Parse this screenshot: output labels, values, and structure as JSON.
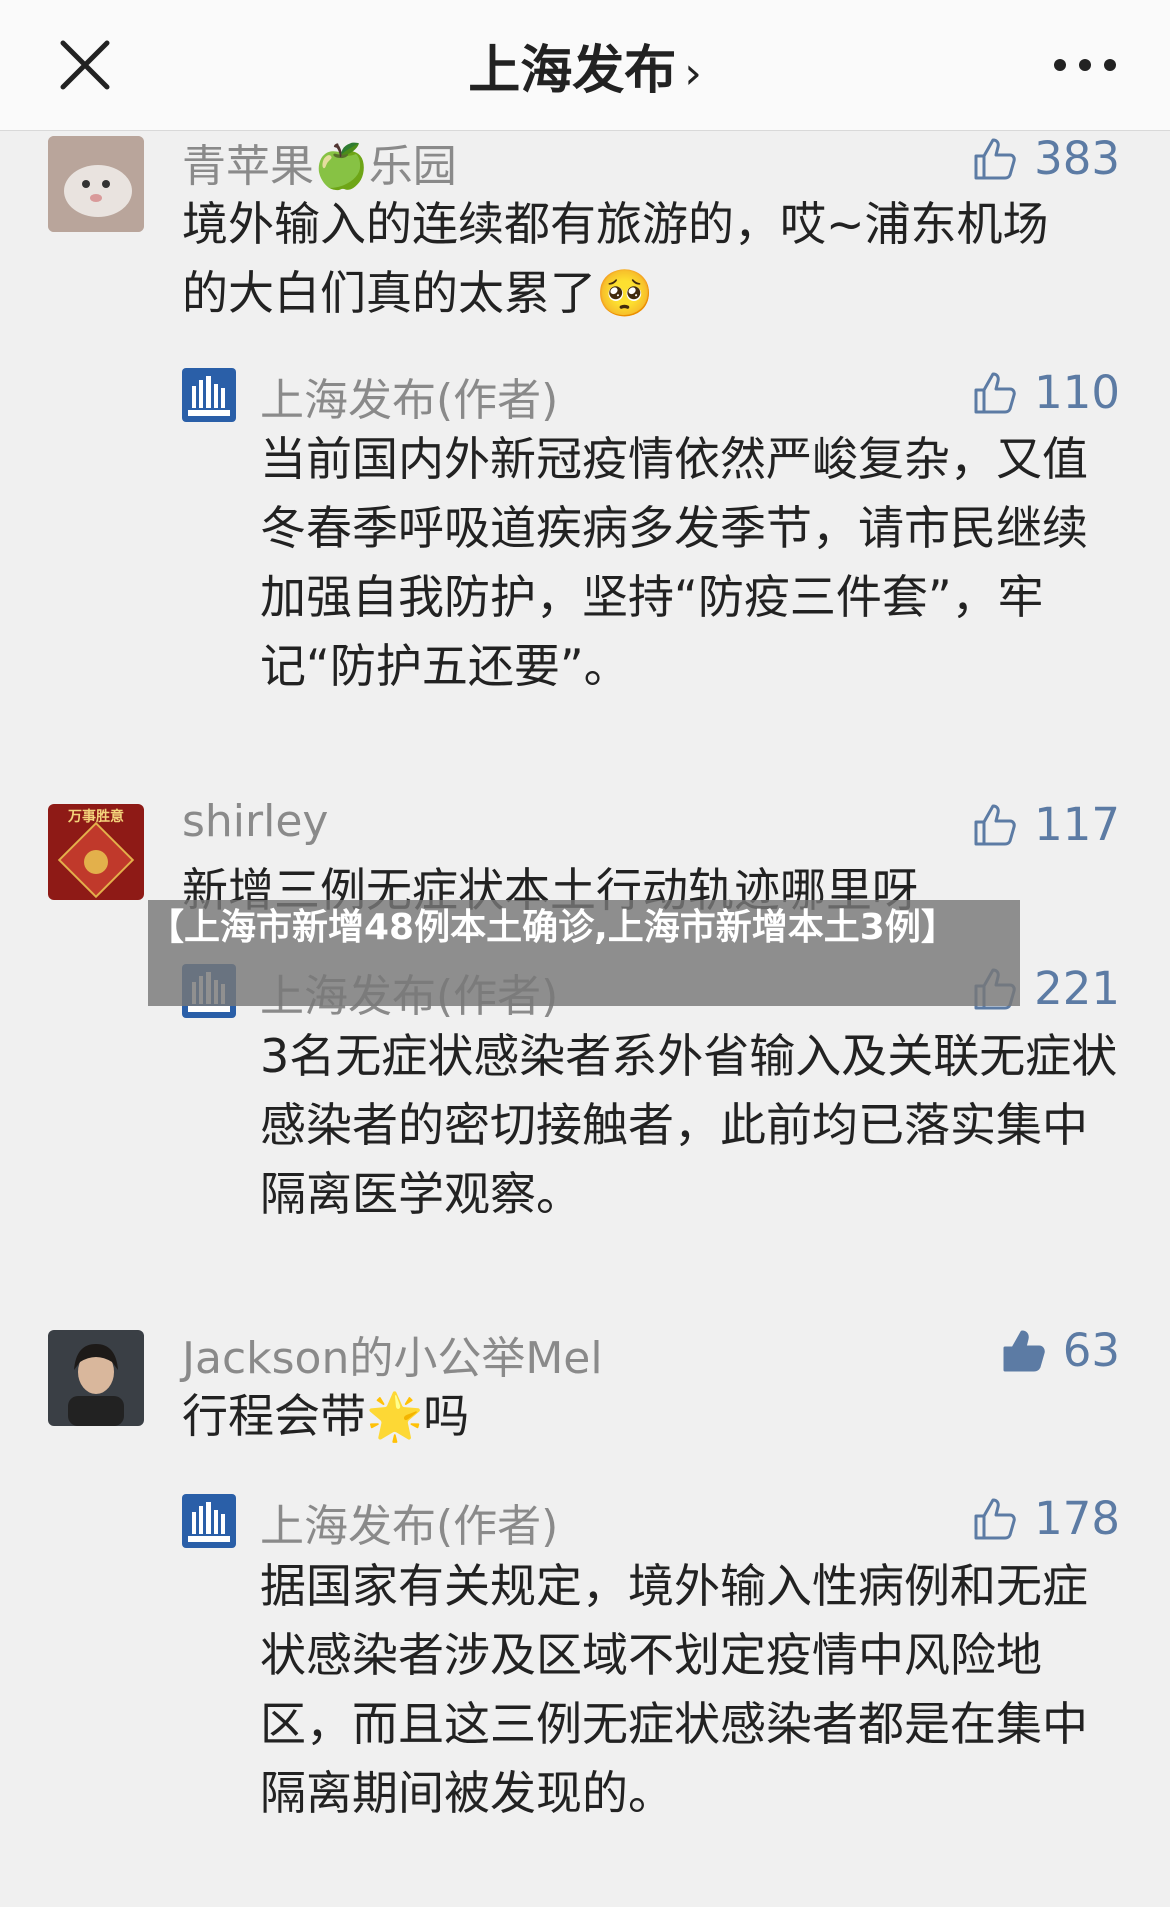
{
  "header": {
    "title": "上海发布",
    "chevron": "›"
  },
  "comments": [
    {
      "user": "青苹果🍏乐园",
      "likes": "383",
      "text": "境外输入的连续都有旅游的，哎~浦东机场的大白们真的太累了🥺",
      "reply": {
        "user": "上海发布(作者)",
        "likes": "110",
        "text": "当前国内外新冠疫情依然严峻复杂，又值冬春季呼吸道疾病多发季节，请市民继续加强自我防护，坚持“防疫三件套”，牢记“防护五还要”。"
      }
    },
    {
      "user": "shirley",
      "likes": "117",
      "avatar_text": "万事胜意",
      "text": "新增三例无症状本土行动轨迹哪里呀",
      "reply": {
        "user": "上海发布(作者)",
        "likes": "221",
        "text": "3名无症状感染者系外省输入及关联无症状感染者的密切接触者，此前均已落实集中隔离医学观察。"
      }
    },
    {
      "user": "Jackson的小公举Mel",
      "likes": "63",
      "text": "行程会带🌟吗",
      "reply": {
        "user": "上海发布(作者)",
        "likes": "178",
        "text": "据国家有关规定，境外输入性病例和无症状感染者涉及区域不划定疫情中风险地区，而且这三例无症状感染者都是在集中隔离期间被发现的。"
      }
    }
  ],
  "overlay": {
    "text": "【上海市新增48例本土确诊,上海市新增本土3例】"
  },
  "colors": {
    "like_blue": "#5c7ba4",
    "name_gray": "#8a8a8a",
    "text": "#222222",
    "bg": "#f0f0f0"
  }
}
